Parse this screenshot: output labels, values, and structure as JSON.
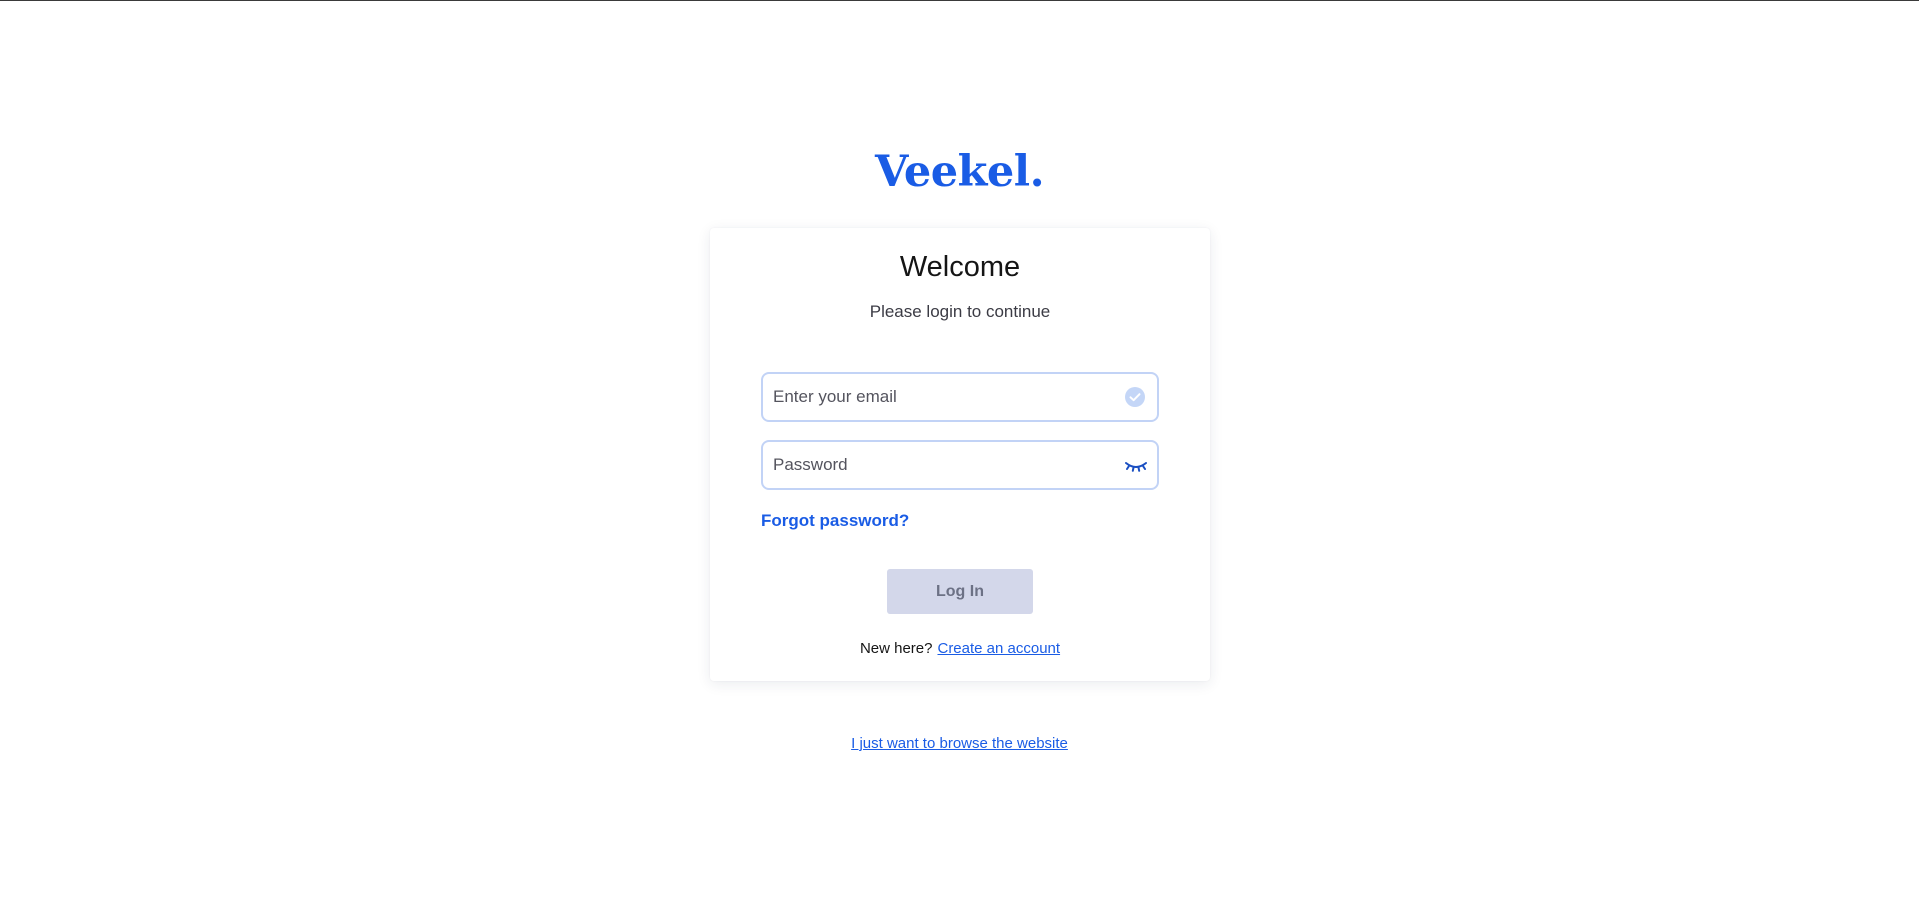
{
  "brand": {
    "logo_text": "Veekel.",
    "accent_color": "#1a5ce5"
  },
  "login_card": {
    "title": "Welcome",
    "subtitle": "Please login to continue",
    "email_field": {
      "placeholder": "Enter your email",
      "value": "",
      "icon": "check-circle-icon"
    },
    "password_field": {
      "placeholder": "Password",
      "value": "",
      "icon": "eye-closed-icon"
    },
    "forgot_password_label": "Forgot password?",
    "login_button_label": "Log In",
    "signup_prompt": "New here?",
    "signup_link_label": "Create an account"
  },
  "browse_link_label": "I just want to browse the website"
}
